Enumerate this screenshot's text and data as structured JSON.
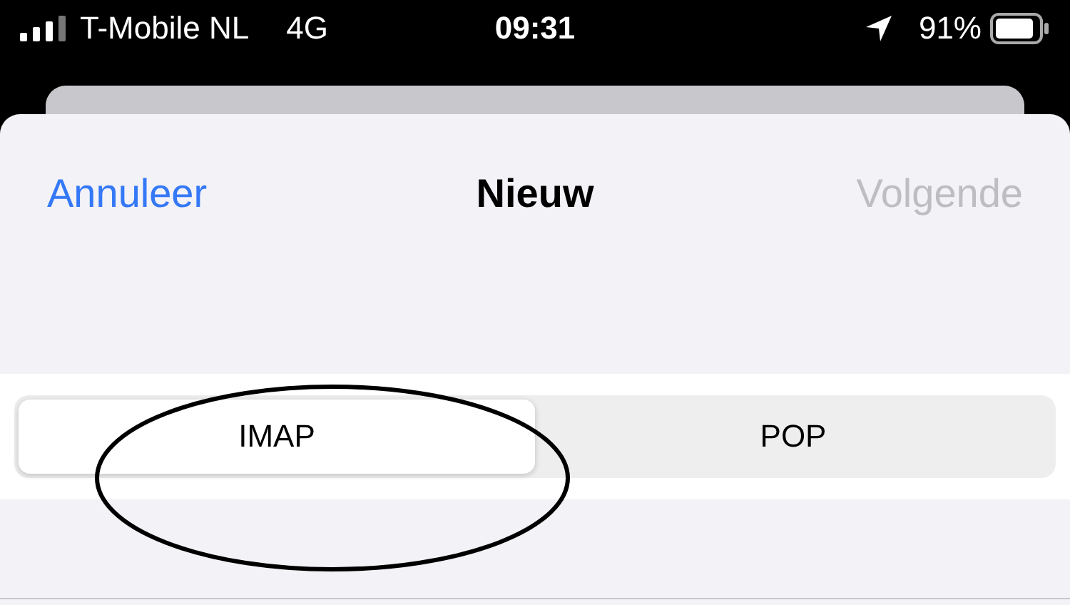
{
  "status_bar": {
    "carrier": "T-Mobile NL",
    "network": "4G",
    "time": "09:31",
    "battery_percent": "91%"
  },
  "nav": {
    "cancel": {
      "label": "Annuleer",
      "disabled": false
    },
    "title": "Nieuw",
    "next": {
      "label": "Volgende",
      "disabled": true
    }
  },
  "segments": [
    {
      "label": "IMAP",
      "selected": true
    },
    {
      "label": "POP",
      "selected": false
    }
  ],
  "annotation": {
    "kind": "ellipse"
  }
}
